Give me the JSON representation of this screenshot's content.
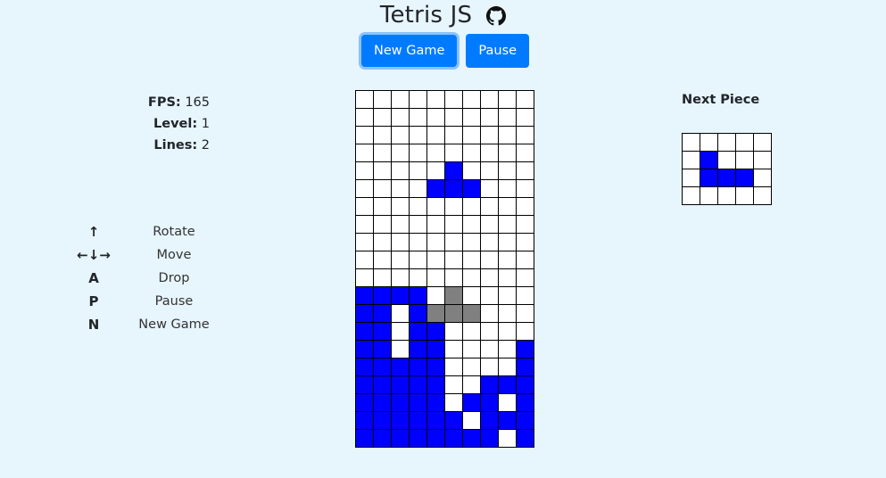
{
  "header": {
    "title": "Tetris JS",
    "github_icon": "github-icon"
  },
  "buttons": {
    "new_game": "New Game",
    "pause": "Pause"
  },
  "stats": {
    "fps_label": "FPS:",
    "fps_value": "165",
    "level_label": "Level:",
    "level_value": "1",
    "lines_label": "Lines:",
    "lines_value": "2"
  },
  "controls": [
    {
      "key": "↑",
      "label": "Rotate"
    },
    {
      "key": "←↓→",
      "label": "Move"
    },
    {
      "key": "A",
      "label": "Drop"
    },
    {
      "key": "P",
      "label": "Pause"
    },
    {
      "key": "N",
      "label": "New Game"
    }
  ],
  "colors": {
    "piece": "#0000ff",
    "ghost": "#808080",
    "empty": "#ffffff",
    "button": "#007bff",
    "background": "#e7f5fd"
  },
  "board": {
    "columns": 10,
    "rows": [
      "..........",
      "..........",
      "..........",
      "..........",
      ".....B....",
      "....BBB...",
      "..........",
      "..........",
      "..........",
      "..........",
      "..........",
      "BBBB.G....",
      "BB.BGGG...",
      "BB.BB.....",
      "BB.BB....B",
      "BBBBB....B",
      "BBBBB..BBB",
      "BBBBB.BB.B",
      "BBBBBB.BBB",
      "BBBBBBBB.B"
    ]
  },
  "next_piece": {
    "title": "Next Piece",
    "rows": [
      ".....",
      ".B...",
      ".BBB.",
      "....."
    ]
  }
}
